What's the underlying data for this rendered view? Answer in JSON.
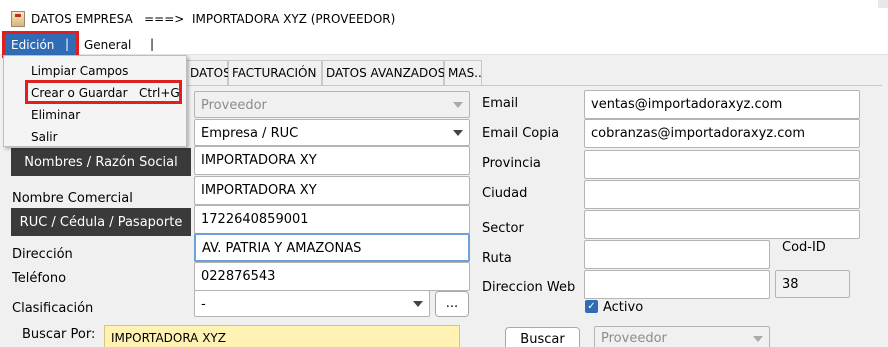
{
  "window": {
    "title": "DATOS EMPRESA   ===>  IMPORTADORA XYZ (PROVEEDOR)"
  },
  "menubar": {
    "edicion": "Edición",
    "separator": "|",
    "general": "General"
  },
  "edicion_menu": {
    "items": [
      {
        "label": "Limpiar Campos",
        "accelerator": ""
      },
      {
        "label": "Crear o Guardar",
        "accelerator": "Ctrl+G"
      },
      {
        "label": "Eliminar",
        "accelerator": ""
      },
      {
        "label": "Salir",
        "accelerator": ""
      }
    ]
  },
  "tabs": [
    "DATOS",
    "FACTURACIÓN",
    "DATOS AVANZADOS",
    "MAS.."
  ],
  "left_form": {
    "tipo_value": "Proveedor",
    "doc_type_value": "Empresa / RUC",
    "nombres_label": "Nombres / Razón Social",
    "nombres_value": "IMPORTADORA XY",
    "nombre_comercial_label": "Nombre Comercial",
    "nombre_comercial_value": "IMPORTADORA XY",
    "ruc_label": "RUC / Cédula / Pasaporte",
    "ruc_value": "1722640859001",
    "direccion_label": "Dirección",
    "direccion_value": "AV. PATRIA Y AMAZONAS",
    "telefono_label": "Teléfono",
    "telefono_value": "022876543",
    "clasificacion_label": "Clasificación",
    "clasificacion_value": "-",
    "clasificacion_button": "..."
  },
  "right_form": {
    "email_label": "Email",
    "email_value": "ventas@importadoraxyz.com",
    "email_copia_label": "Email Copia",
    "email_copia_value": "cobranzas@importadoraxyz.com",
    "provincia_label": "Provincia",
    "provincia_value": "",
    "ciudad_label": "Ciudad",
    "ciudad_value": "",
    "sector_label": "Sector",
    "sector_value": "",
    "ruta_label": "Ruta",
    "ruta_value": "",
    "codid_label": "Cod-ID",
    "codid_value": "38",
    "web_label": "Direccion Web",
    "web_value": "",
    "activo_label": "Activo",
    "activo_checked": true
  },
  "search": {
    "label": "Buscar Por:",
    "value": "IMPORTADORA XYZ",
    "button": "Buscar",
    "filter_value": "Proveedor"
  },
  "colors": {
    "menu_highlight": "#2f6cb5",
    "annotation_red": "#e02020",
    "dark_label": "#3a3a3a",
    "search_bg": "#fff2b3"
  }
}
